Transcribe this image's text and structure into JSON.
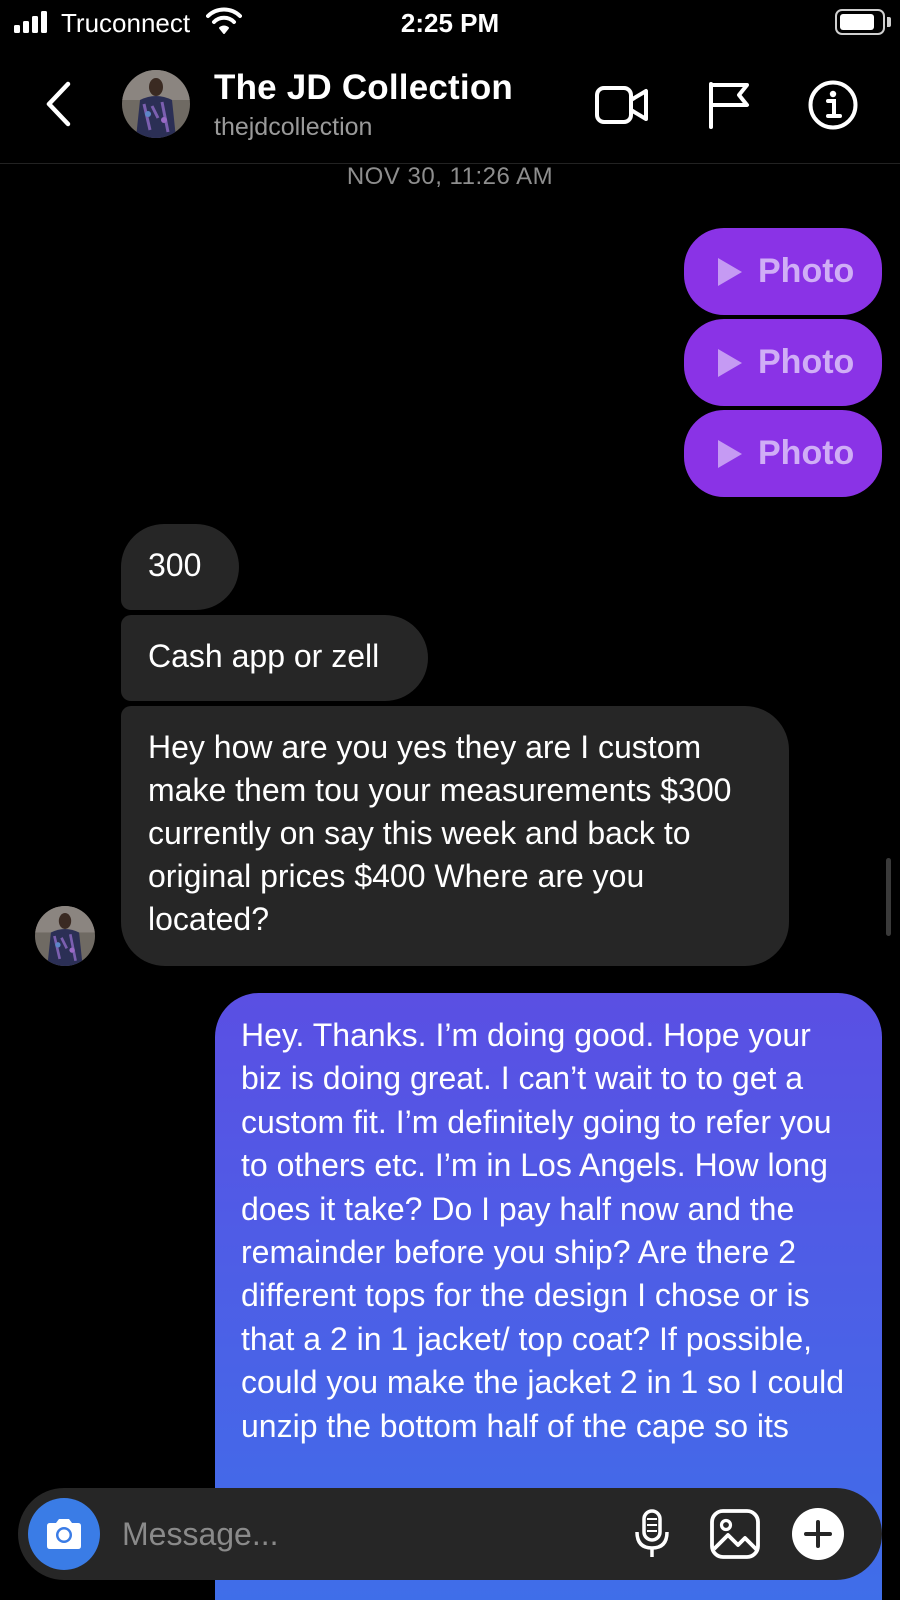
{
  "status_bar": {
    "carrier": "Truconnect",
    "time": "2:25 PM",
    "battery_level": 0.85
  },
  "header": {
    "contact_name": "The JD Collection",
    "contact_handle": "thejdcollection",
    "icons": [
      "back-icon",
      "video-call-icon",
      "report-flag-icon",
      "info-icon"
    ]
  },
  "conversation": {
    "timestamp": "NOV 30, 11:26 AM",
    "sent_photos": [
      {
        "label": "Photo"
      },
      {
        "label": "Photo"
      },
      {
        "label": "Photo"
      }
    ],
    "received": [
      {
        "text": "300"
      },
      {
        "text": "Cash app or zell"
      },
      {
        "text": "Hey how are you yes they are I custom make them tou your measurements $300 currently on say this week and back to original prices $400 Where are you located?"
      }
    ],
    "sent_text": "Hey. Thanks. I’m doing good. Hope your biz is doing great. I can’t wait to to get a custom fit. I’m definitely going to refer you to others etc. I’m in Los Angels. How long does it take? Do I pay half now and the remainder before you ship? Are there 2 different tops for the design I chose or is that a 2 in 1 jacket/ top coat? If possible, could you make the jacket 2 in 1 so I could unzip the bottom half of the cape so its"
  },
  "composer": {
    "placeholder": "Message...",
    "icons": [
      "camera-icon",
      "microphone-icon",
      "gallery-icon",
      "plus-icon"
    ]
  },
  "colors": {
    "background": "#000000",
    "received_bubble": "#262626",
    "photo_bubble": "#8a33e6",
    "sent_gradient_top": "#5a4fe3",
    "sent_gradient_bottom": "#3f6ee9",
    "camera_button": "#3a7ce6"
  }
}
